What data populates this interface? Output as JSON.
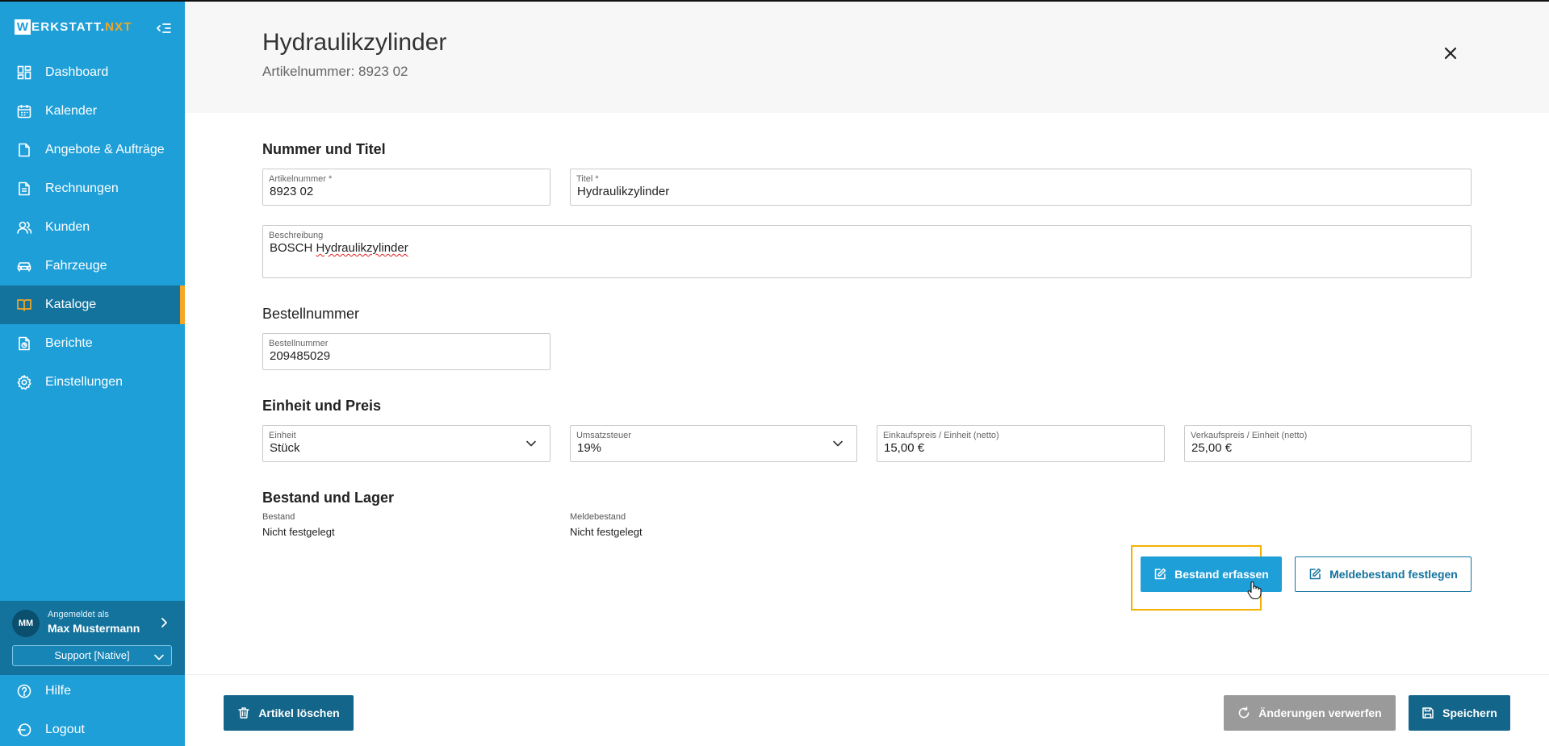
{
  "app": {
    "logo_letter": "W",
    "logo_text": "ERKSTATT.",
    "logo_accent": "NXT",
    "brand_color": "#1e9fd8",
    "accent_color": "#f5a623"
  },
  "sidebar": {
    "items": [
      {
        "label": "Dashboard",
        "icon": "dashboard-icon"
      },
      {
        "label": "Kalender",
        "icon": "calendar-icon"
      },
      {
        "label": "Angebote & Aufträge",
        "icon": "document-icon"
      },
      {
        "label": "Rechnungen",
        "icon": "invoice-icon"
      },
      {
        "label": "Kunden",
        "icon": "users-icon"
      },
      {
        "label": "Fahrzeuge",
        "icon": "car-icon"
      },
      {
        "label": "Kataloge",
        "icon": "book-icon",
        "active": true
      },
      {
        "label": "Berichte",
        "icon": "report-icon"
      },
      {
        "label": "Einstellungen",
        "icon": "gear-icon"
      }
    ],
    "user": {
      "initials": "MM",
      "caption": "Angemeldet als",
      "name": "Max Mustermann",
      "role_select": "Support [Native]"
    },
    "bottom_items": [
      {
        "label": "Hilfe",
        "icon": "help-icon"
      },
      {
        "label": "Logout",
        "icon": "logout-icon"
      }
    ]
  },
  "header": {
    "title": "Hydraulikzylinder",
    "subtitle": "Artikelnummer: 8923 02"
  },
  "sections": {
    "nummer_titel": "Nummer und Titel",
    "bestellnummer": "Bestellnummer",
    "einheit_preis": "Einheit und Preis",
    "bestand_lager": "Bestand und Lager"
  },
  "fields": {
    "artikelnummer": {
      "label": "Artikelnummer *",
      "value": "8923 02"
    },
    "titel": {
      "label": "Titel *",
      "value": "Hydraulikzylinder"
    },
    "beschreibung": {
      "label": "Beschreibung",
      "value_prefix": "BOSCH ",
      "value_marked": "Hydraulikzylinder"
    },
    "bestellnummer": {
      "label": "Bestellnummer",
      "value": "209485029"
    },
    "einheit": {
      "label": "Einheit",
      "value": "Stück"
    },
    "umsatzsteuer": {
      "label": "Umsatzsteuer",
      "value": "19%"
    },
    "einkaufspreis": {
      "label": "Einkaufspreis / Einheit (netto)",
      "value": "15,00 €"
    },
    "verkaufspreis": {
      "label": "Verkaufspreis / Einheit (netto)",
      "value": "25,00 €"
    }
  },
  "stock": {
    "bestand_label": "Bestand",
    "bestand_value": "Nicht festgelegt",
    "meldebestand_label": "Meldebestand",
    "meldebestand_value": "Nicht festgelegt"
  },
  "actions": {
    "bestand_erfassen": "Bestand erfassen",
    "meldebestand_festlegen": "Meldebestand festlegen"
  },
  "footer": {
    "delete": "Artikel löschen",
    "discard": "Änderungen verwerfen",
    "save": "Speichern"
  }
}
